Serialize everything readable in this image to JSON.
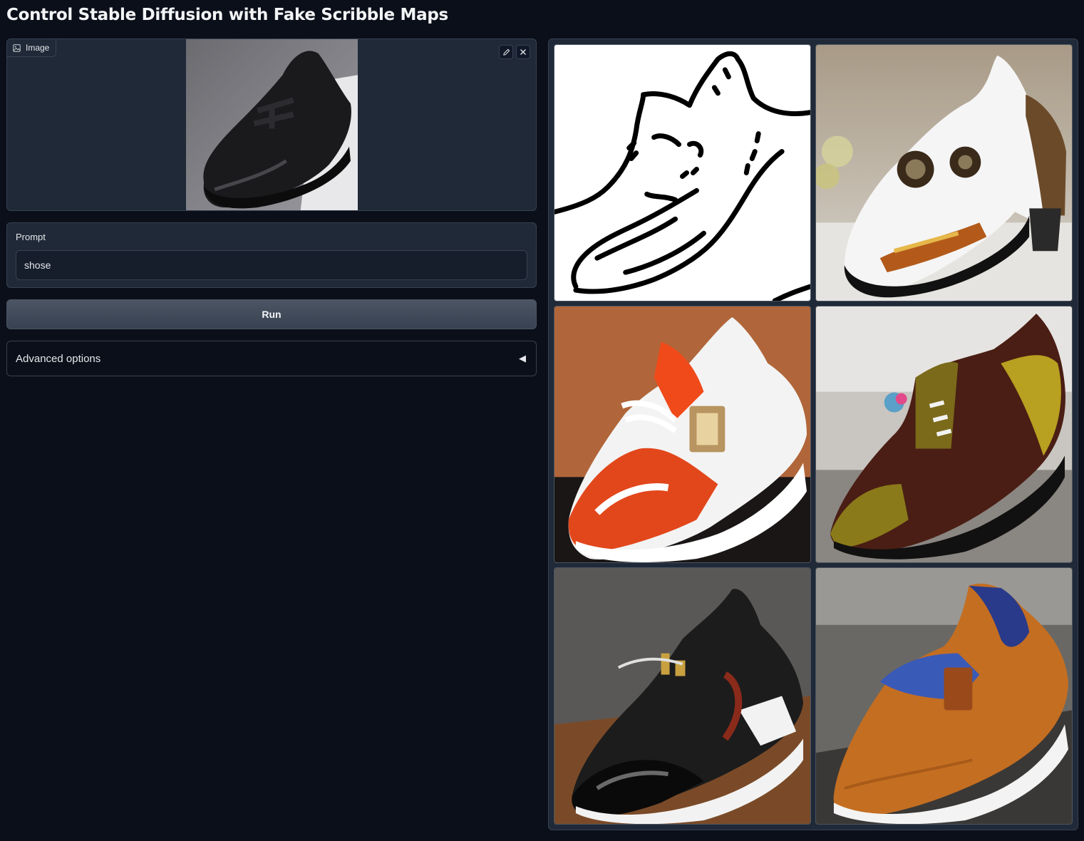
{
  "page": {
    "title": "Control Stable Diffusion with Fake Scribble Maps"
  },
  "image_input": {
    "label": "Image",
    "label_icon": "image-icon",
    "edit_icon": "pencil-icon",
    "clear_icon": "close-icon"
  },
  "prompt": {
    "label": "Prompt",
    "value": "shose"
  },
  "run_button": {
    "label": "Run"
  },
  "advanced": {
    "label": "Advanced options",
    "icon": "triangle-left-icon"
  },
  "gallery": {
    "items": [
      {
        "name": "scribble-map"
      },
      {
        "name": "white-dress-shoe-result"
      },
      {
        "name": "orange-sneaker-result"
      },
      {
        "name": "brown-gold-shoe-result"
      },
      {
        "name": "black-leather-sneaker-result"
      },
      {
        "name": "tan-leather-shoe-result"
      }
    ]
  },
  "colors": {
    "background": "#0b0f19",
    "panel": "#1f2937",
    "border": "#374151"
  }
}
